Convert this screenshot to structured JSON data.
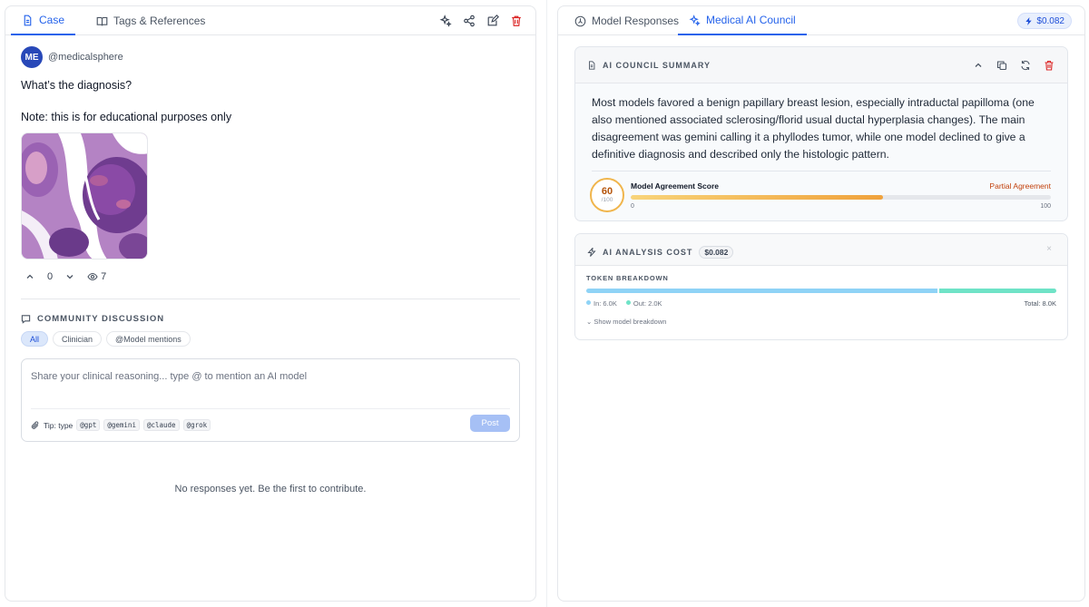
{
  "left": {
    "tabs": [
      {
        "label": "Case",
        "icon": "document-icon",
        "active": true
      },
      {
        "label": "Tags & References",
        "icon": "book-icon",
        "active": false
      }
    ],
    "toolbar": [
      "sparkles-icon",
      "share-icon",
      "edit-icon",
      "trash-icon"
    ],
    "post": {
      "avatar_initials": "ME",
      "username": "@medicalsphere",
      "question": "What’s the diagnosis?",
      "note": "Note: this is for educational purposes only",
      "upvotes": "0",
      "views": "7"
    },
    "discussion": {
      "title": "COMMUNITY DISCUSSION",
      "filters": [
        "All",
        "Clinician",
        "@Model mentions"
      ],
      "active_filter": "All",
      "composer_placeholder": "Share your clinical reasoning... type @ to mention an AI model",
      "tip_label": "Tip: type",
      "mentions": [
        "@gpt",
        "@gemini",
        "@claude",
        "@grok"
      ],
      "post_label": "Post",
      "empty_text": "No responses yet. Be the first to contribute."
    }
  },
  "right": {
    "tabs": [
      {
        "label": "Model Responses",
        "icon": "cpu-icon",
        "active": false
      },
      {
        "label": "Medical AI Council",
        "icon": "sparkles-icon",
        "active": true
      }
    ],
    "total_cost": "$0.082",
    "summary": {
      "title": "AI COUNCIL SUMMARY",
      "text": "Most models favored a benign papillary breast lesion, especially intraductal papilloma (one also mentioned associated sclerosing/florid usual ductal hyperplasia changes). The main disagreement was gemini calling it a phyllodes tumor, while one model declined to give a definitive diagnosis and described only the histologic pattern.",
      "score": 60,
      "score_value": "60",
      "score_denominator": "/100",
      "agreement_label": "Model Agreement Score",
      "agreement_status": "Partial Agreement",
      "scale_min": "0",
      "scale_max": "100"
    },
    "cost": {
      "title": "AI ANALYSIS COST",
      "badge": "$0.082",
      "close": "×",
      "breakdown_label": "TOKEN BREAKDOWN",
      "tokens_in": 6.0,
      "tokens_out": 2.0,
      "in_label": "In: 6.0K",
      "out_label": "Out: 2.0K",
      "total_label": "Total: 8.0K",
      "show_more": "Show model breakdown"
    },
    "colors": {
      "accent": "#2563eb",
      "token_in": "#8fd3f6",
      "token_out": "#6fe3c7",
      "score": "#f0a23c"
    }
  }
}
